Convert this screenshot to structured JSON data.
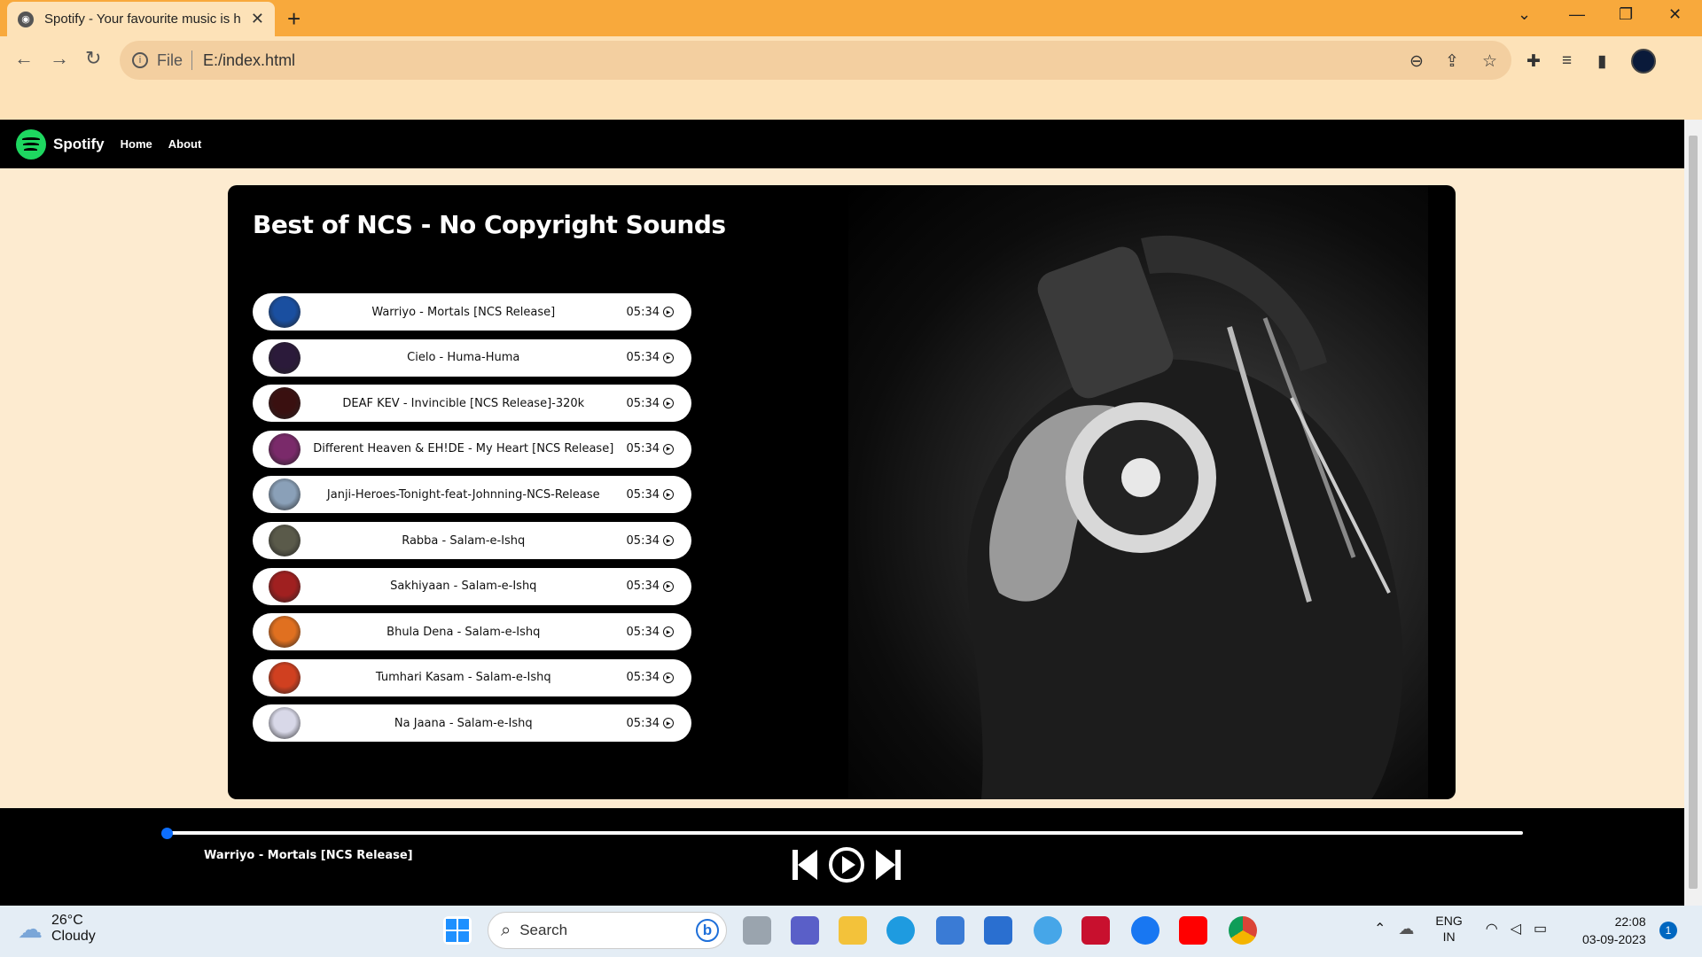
{
  "browser": {
    "tab_title": "Spotify - Your favourite music is h",
    "url_scheme": "File",
    "url": "E:/index.html"
  },
  "site": {
    "brand": "Spotify",
    "nav": [
      "Home",
      "About"
    ]
  },
  "playlist": {
    "heading": "Best of NCS - No Copyright Sounds",
    "songs": [
      {
        "name": "Warriyo - Mortals [NCS Release]",
        "duration": "05:34",
        "cover_color": "#1a4fa0"
      },
      {
        "name": "Cielo - Huma-Huma",
        "duration": "05:34",
        "cover_color": "#2b1a3a"
      },
      {
        "name": "DEAF KEV - Invincible [NCS Release]-320k",
        "duration": "05:34",
        "cover_color": "#3a1010"
      },
      {
        "name": "Different Heaven & EH!DE - My Heart [NCS Release]",
        "duration": "05:34",
        "cover_color": "#7a2a6a"
      },
      {
        "name": "Janji-Heroes-Tonight-feat-Johnning-NCS-Release",
        "duration": "05:34",
        "cover_color": "#8aa0b8"
      },
      {
        "name": "Rabba - Salam-e-Ishq",
        "duration": "05:34",
        "cover_color": "#5a5a4a"
      },
      {
        "name": "Sakhiyaan - Salam-e-Ishq",
        "duration": "05:34",
        "cover_color": "#a02020"
      },
      {
        "name": "Bhula Dena - Salam-e-Ishq",
        "duration": "05:34",
        "cover_color": "#e07020"
      },
      {
        "name": "Tumhari Kasam - Salam-e-Ishq",
        "duration": "05:34",
        "cover_color": "#d04020"
      },
      {
        "name": "Na Jaana - Salam-e-Ishq",
        "duration": "05:34",
        "cover_color": "#d8d8e8"
      }
    ]
  },
  "player": {
    "now_playing": "Warriyo - Mortals [NCS Release]",
    "progress": 0
  },
  "taskbar": {
    "temperature": "26°C",
    "condition": "Cloudy",
    "search_placeholder": "Search",
    "lang_1": "ENG",
    "lang_2": "IN",
    "time": "22:08",
    "date": "03-09-2023",
    "notifications": "1"
  }
}
